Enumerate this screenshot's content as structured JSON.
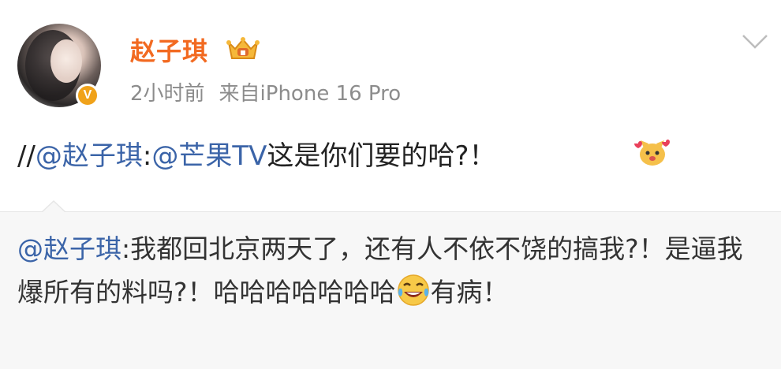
{
  "post": {
    "author": "赵子琪",
    "time": "2小时前",
    "source": "来自iPhone 16 Pro",
    "repost_prefix": "//",
    "repost_mention_author": "@赵子琪",
    "repost_colon": ":",
    "repost_mention_target": "@芒果TV",
    "repost_body": "这是你们要的哈?！"
  },
  "quote": {
    "mention": "@赵子琪",
    "colon": ":",
    "text_part1": "我都回北京两天了，还有人不依不饶的搞我?！是逼我爆所有的料吗?！哈哈哈哈哈哈哈",
    "text_part2": "有病！"
  },
  "icons": {
    "verify": "verified-v-badge",
    "crown": "crown-badge-icon",
    "chevron": "chevron-down-icon",
    "dog": "dog-emoji-icon",
    "laugh": "laughing-tears-emoji-icon"
  },
  "colors": {
    "username": "#f26a21",
    "mention": "#3b64a8",
    "meta": "#8c8c8c",
    "quote_bg": "#f7f7f7"
  }
}
